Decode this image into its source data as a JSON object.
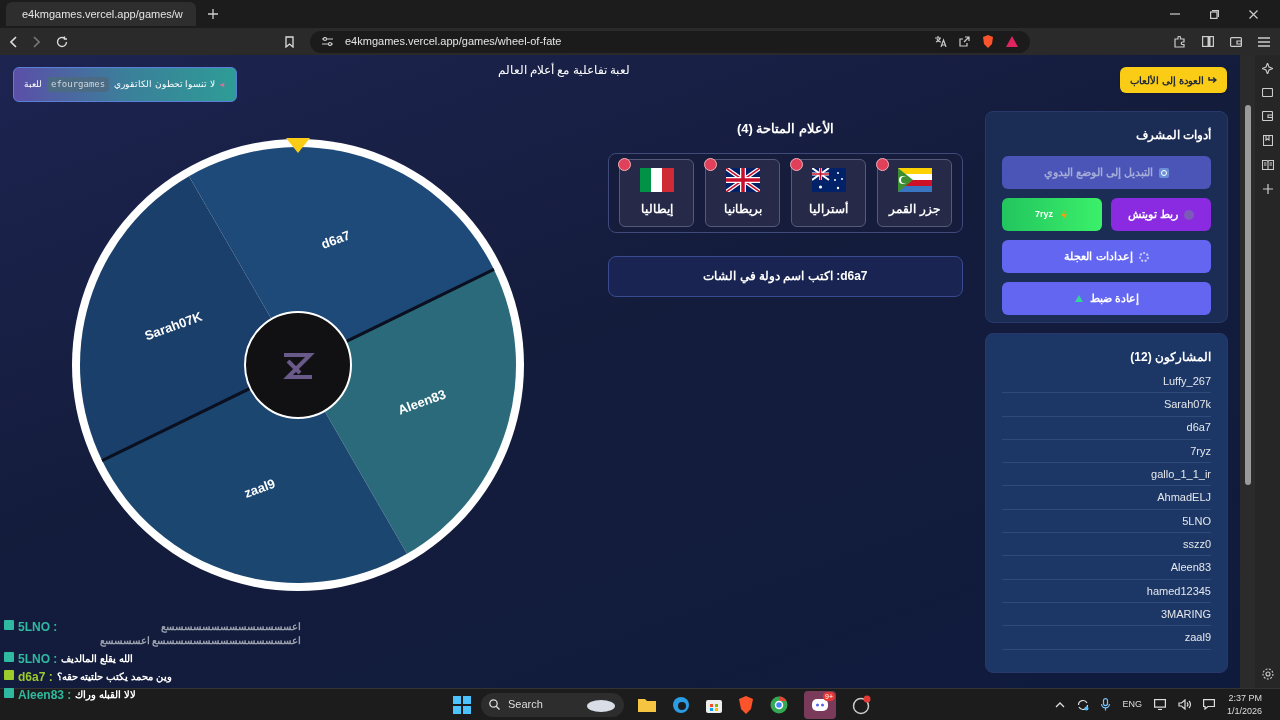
{
  "browser": {
    "tab_title": "e4kmgames.vercel.app/games/w",
    "url": "e4kmgames.vercel.app/games/wheel-of-fate"
  },
  "banner": [
    {
      "kind": "text",
      "text": "لا تنسوا تحطون الكاتقوري"
    },
    {
      "kind": "code",
      "text": "efourgames"
    },
    {
      "kind": "text",
      "text": "للعبة"
    }
  ],
  "subtitle": "لعبة تفاعلية مع أعلام العالم",
  "back_button": "العودة إلى الألعاب",
  "wheel": {
    "segments": [
      {
        "label": "d6a7"
      },
      {
        "label": "Aleen83"
      },
      {
        "label": "zaal9"
      },
      {
        "label": "Sarah07K"
      }
    ]
  },
  "flags": {
    "title": "الأعلام المتاحة (4)",
    "items": [
      {
        "kind": "comoros",
        "name": "جزر القمر"
      },
      {
        "kind": "australia",
        "name": "أستراليا"
      },
      {
        "kind": "uk",
        "name": "بريطانيا"
      },
      {
        "kind": "italy",
        "name": "إيطاليا"
      }
    ]
  },
  "prompt": "**d6a7:** اكتب اسم دولة في الشات",
  "admin": {
    "title": "أدوات المشرف",
    "buttons": [
      {
        "kind": "mode",
        "label": "التبديل إلى الوضع اليدوي",
        "disabled": true
      },
      {
        "kind": "twitch",
        "label": "ربط تويتش",
        "disabled": false
      },
      {
        "kind": "user",
        "label": "7ryz",
        "disabled": false
      },
      {
        "kind": "settings",
        "label": "إعدادات العجلة",
        "disabled": false
      },
      {
        "kind": "reset",
        "label": "إعادة ضبط",
        "disabled": false
      }
    ]
  },
  "participants": {
    "title": "المشاركون (12)",
    "names": [
      "Luffy_267",
      "Sarah07k",
      "d6a7",
      "7ryz",
      "gallo_1_1_ir",
      "AhmadELJ",
      "5LNO",
      "sszz0",
      "Aleen83",
      "hamed12345",
      "3MARING",
      "zaal9"
    ]
  },
  "chat": [
    {
      "user": "5LNO :",
      "color": "#2fb9a0",
      "text": "اعسسسسسسسسسسسسسسع اعسسسسسسسسسسسسسسسع اعسسسسع",
      "faded": true
    },
    {
      "user": "5LNO :",
      "color": "#2fb9a0",
      "text": "الله يقلع المالديف",
      "faded": false
    },
    {
      "user": "d6a7 :",
      "color": "#9ccc2c",
      "text": "وين محمد يكتب حلتيته حقه؟",
      "faded": false
    },
    {
      "user": "Aleen83 :",
      "color": "#2fb9a0",
      "text": "لالا القبله وراك",
      "faded": false
    }
  ],
  "taskbar": {
    "search": "Search",
    "badge": "9+",
    "language": "ENG",
    "time": "2:37 PM",
    "date": "1/1/2026"
  }
}
